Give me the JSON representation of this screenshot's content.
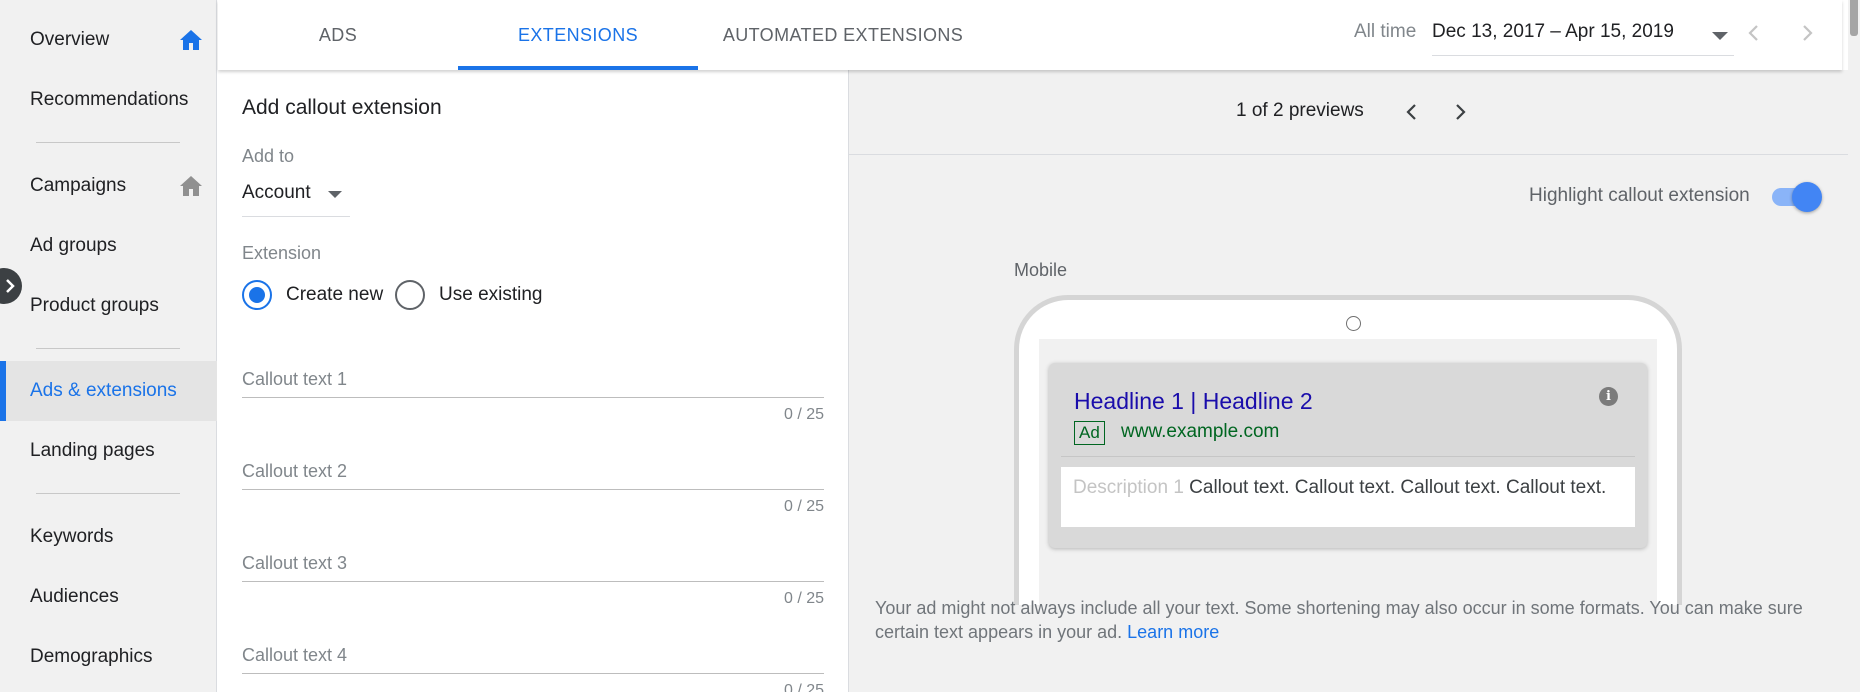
{
  "sidebar": {
    "items": [
      {
        "label": "Overview",
        "has_home": true,
        "home_color": "#1a73e8"
      },
      {
        "label": "Recommendations"
      },
      {
        "label": "Campaigns",
        "has_home": true,
        "home_color": "#909090"
      },
      {
        "label": "Ad groups"
      },
      {
        "label": "Product groups"
      },
      {
        "label": "Ads & extensions",
        "active": true
      },
      {
        "label": "Landing pages"
      },
      {
        "label": "Keywords"
      },
      {
        "label": "Audiences"
      },
      {
        "label": "Demographics"
      }
    ],
    "collapse_icon": "chevron-right-icon"
  },
  "tabs": [
    {
      "label": "ADS"
    },
    {
      "label": "EXTENSIONS",
      "active": true
    },
    {
      "label": "AUTOMATED EXTENSIONS"
    }
  ],
  "date_range": {
    "label": "All time",
    "value": "Dec 13, 2017 – Apr 15, 2019"
  },
  "form": {
    "title": "Add callout extension",
    "add_to_label": "Add to",
    "add_to_value": "Account",
    "extension_label": "Extension",
    "radio_create": "Create new",
    "radio_existing": "Use existing",
    "selected": "create",
    "fields": [
      {
        "placeholder": "Callout text 1",
        "value": "",
        "counter": "0 / 25"
      },
      {
        "placeholder": "Callout text 2",
        "value": "",
        "counter": "0 / 25"
      },
      {
        "placeholder": "Callout text 3",
        "value": "",
        "counter": "0 / 25"
      },
      {
        "placeholder": "Callout text 4",
        "value": "",
        "counter": "0 / 25"
      }
    ]
  },
  "preview": {
    "count": "1 of 2 previews",
    "toggle_label": "Highlight callout extension",
    "toggle_on": true,
    "device_label": "Mobile",
    "ad": {
      "headline": "Headline 1 | Headline 2",
      "badge": "Ad",
      "url": "www.example.com",
      "desc_placeholder": "Description 1",
      "callouts": "Callout text. Callout text. Callout text. Callout text."
    },
    "disclaimer": "Your ad might not always include all your text. Some shortening may also occur in some formats. You can make sure certain text appears in your ad.",
    "learn_more": "Learn more"
  },
  "colors": {
    "accent": "#1a73e8",
    "url_green": "#006621",
    "headline_blue": "#1a0dab"
  }
}
